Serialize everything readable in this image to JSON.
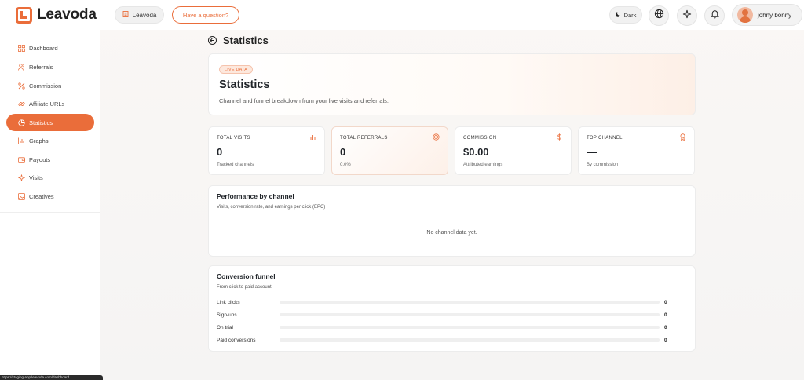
{
  "header": {
    "brand": "Leavoda",
    "workspace_label": "Leavoda",
    "question_label": "Have a question?",
    "theme_label": "Dark",
    "user_name": "johny bonny"
  },
  "sidebar": {
    "items": [
      {
        "label": "Dashboard",
        "icon": "grid-icon"
      },
      {
        "label": "Referrals",
        "icon": "users-icon"
      },
      {
        "label": "Commission",
        "icon": "percent-icon"
      },
      {
        "label": "Affiliate URLs",
        "icon": "link-icon"
      },
      {
        "label": "Statistics",
        "icon": "pie-chart-icon",
        "active": true
      },
      {
        "label": "Graphs",
        "icon": "bar-chart-icon"
      },
      {
        "label": "Payouts",
        "icon": "wallet-icon"
      },
      {
        "label": "Visits",
        "icon": "sparkle-icon"
      },
      {
        "label": "Creatives",
        "icon": "image-icon"
      }
    ]
  },
  "page": {
    "title": "Statistics"
  },
  "hero": {
    "badge": "LIVE DATA",
    "title": "Statistics",
    "subtitle": "Channel and funnel breakdown from your live visits and referrals."
  },
  "stats": [
    {
      "label": "TOTAL VISITS",
      "value": "0",
      "sub": "Tracked channels",
      "icon": "bar-chart-icon"
    },
    {
      "label": "TOTAL REFERRALS",
      "value": "0",
      "sub": "0.0%",
      "icon": "target-icon"
    },
    {
      "label": "COMMISSION",
      "value": "$0.00",
      "sub": "Attributed earnings",
      "icon": "dollar-icon"
    },
    {
      "label": "TOP CHANNEL",
      "value": "—",
      "sub": "By commission",
      "icon": "award-icon"
    }
  ],
  "performance": {
    "title": "Performance by channel",
    "subtitle": "Visits, conversion rate, and earnings per click (EPC)",
    "empty_message": "No channel data yet."
  },
  "funnel": {
    "title": "Conversion funnel",
    "subtitle": "From click to paid account",
    "rows": [
      {
        "label": "Link clicks",
        "count": "0",
        "progress": 0
      },
      {
        "label": "Sign-ups",
        "count": "0",
        "progress": 0
      },
      {
        "label": "On trial",
        "count": "0",
        "progress": 0
      },
      {
        "label": "Paid conversions",
        "count": "0",
        "progress": 0
      }
    ]
  },
  "status_bar": {
    "url": "https://staging-app.leavoda.com/dashboard"
  },
  "colors": {
    "accent": "#ea6d3a"
  }
}
